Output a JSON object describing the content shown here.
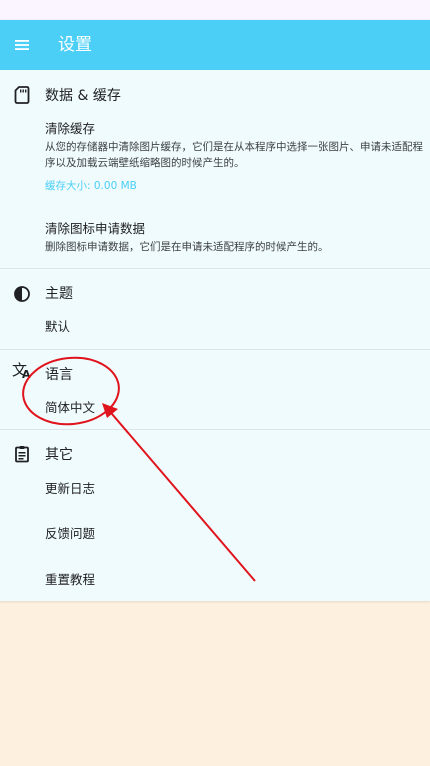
{
  "app_bar": {
    "title": "设置",
    "menu_icon": "menu-icon",
    "background_color": "#4bcff6"
  },
  "sections": {
    "data_cache": {
      "icon": "sd-card-icon",
      "title": "数据 & 缓存",
      "clear_cache": {
        "title": "清除缓存",
        "description": "从您的存储器中清除图片缓存，它们是在从本程序中选择一张图片、申请未适配程序以及加载云端壁纸缩略图的时候产生的。",
        "cache_size": "缓存大小: 0.00 MB"
      },
      "clear_icon_requests": {
        "title": "清除图标申请数据",
        "description": "删除图标申请数据，它们是在申请未适配程序的时候产生的。"
      }
    },
    "theme": {
      "icon": "contrast-icon",
      "title": "主题",
      "value": "默认"
    },
    "language": {
      "icon": "translate-icon",
      "title": "语言",
      "value": "简体中文"
    },
    "other": {
      "icon": "clipboard-icon",
      "title": "其它",
      "items": [
        "更新日志",
        "反馈问题",
        "重置教程"
      ]
    }
  },
  "colors": {
    "accent": "#4bcff6",
    "content_background": "#f0fbfd",
    "page_background": "#fdf0de",
    "annotation": "#e0141c"
  }
}
